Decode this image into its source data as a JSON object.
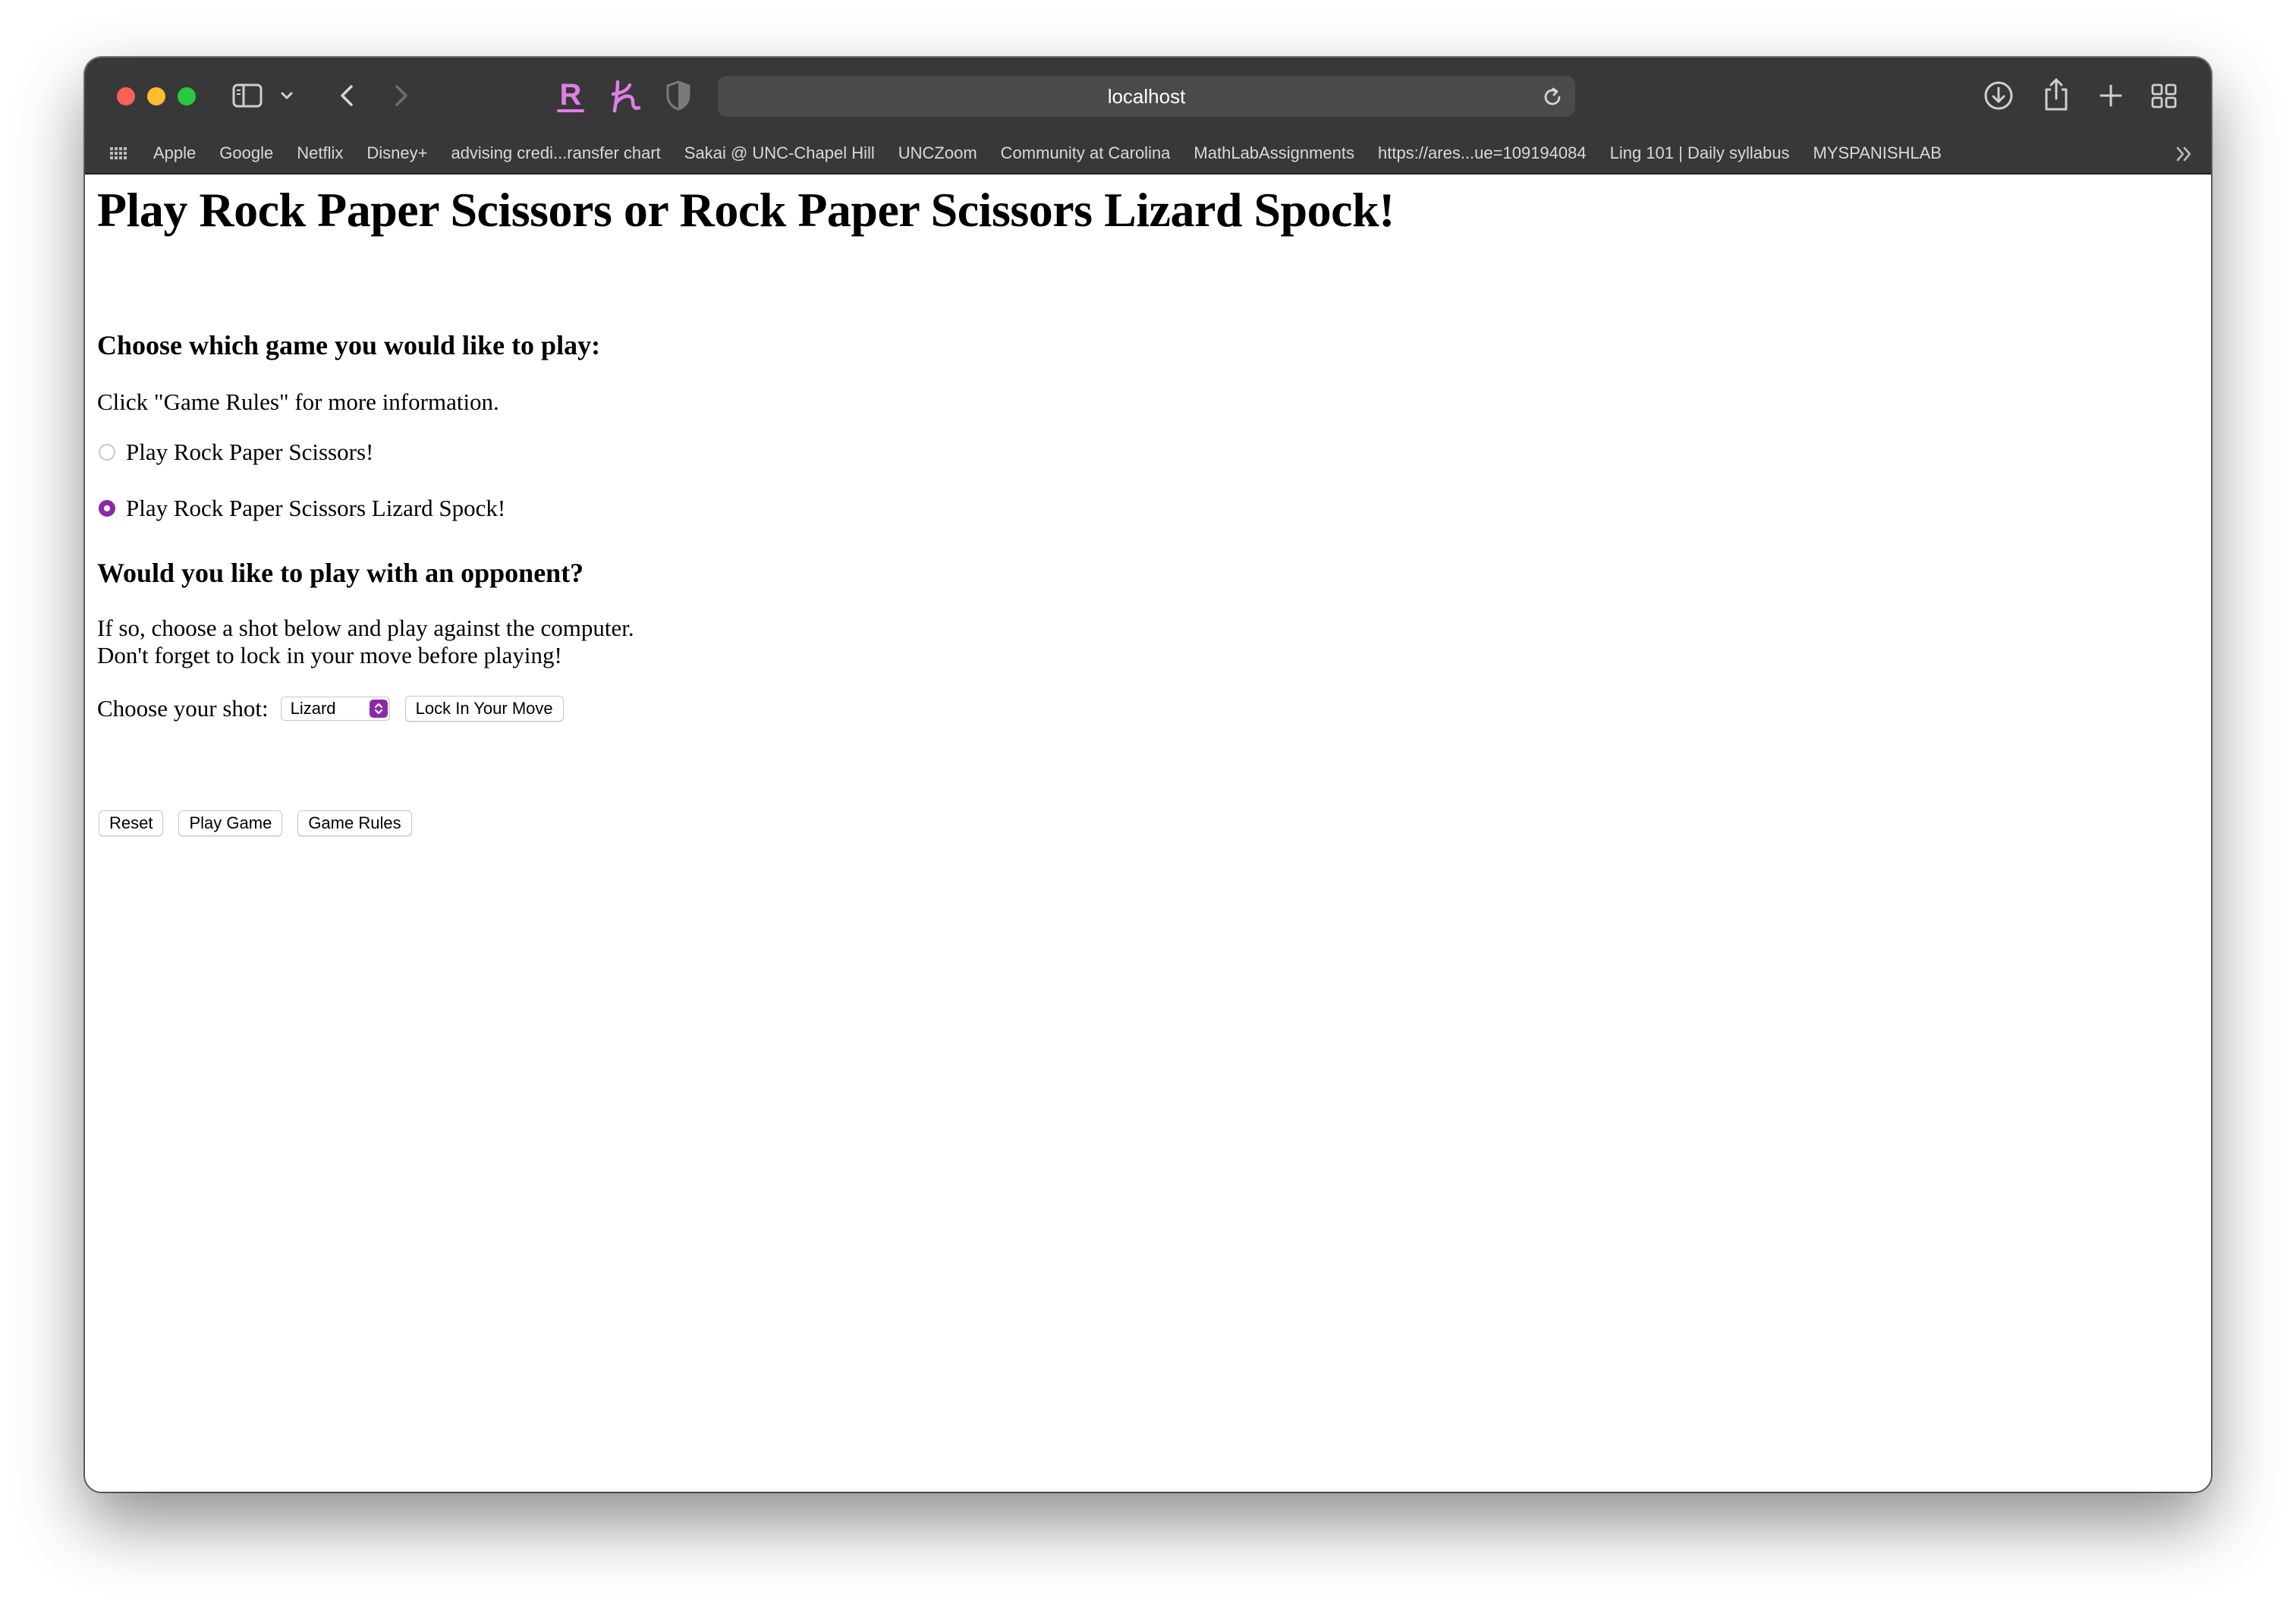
{
  "browser": {
    "address": "localhost",
    "bookmarks": [
      "Apple",
      "Google",
      "Netflix",
      "Disney+",
      "advising credi...ransfer chart",
      "Sakai @ UNC-Chapel Hill",
      "UNCZoom",
      "Community at Carolina",
      "MathLabAssignments",
      "https://ares...ue=109194084",
      "Ling 101 | Daily syllabus",
      "MYSPANISHLAB"
    ],
    "icons": {
      "sidebar": "sidebar-icon",
      "back": "chevron-left-icon",
      "forward": "chevron-right-icon",
      "reload": "reload-icon",
      "download": "download-icon",
      "share": "share-icon",
      "new_tab": "plus-icon",
      "tab_overview": "grid-icon"
    },
    "extensions": {
      "r_logo_letter": "R",
      "h_logo_letter": "h"
    },
    "colors": {
      "chrome": "#383838",
      "accent": "#8a2aa6",
      "extension": "#e07fe8"
    }
  },
  "page": {
    "title": "Play Rock Paper Scissors or Rock Paper Scissors Lizard Spock!",
    "choose_heading": "Choose which game you would like to play:",
    "info_text": "Click \"Game Rules\" for more information.",
    "game_options": [
      {
        "label": "Play Rock Paper Scissors!",
        "checked": false
      },
      {
        "label": "Play Rock Paper Scissors Lizard Spock!",
        "checked": true
      }
    ],
    "opponent_heading": "Would you like to play with an opponent?",
    "opponent_line1": "If so, choose a shot below and play against the computer.",
    "opponent_line2": "Don't forget to lock in your move before playing!",
    "shot_label": "Choose your shot:",
    "shot_selected": "Lizard",
    "lock_button": "Lock In Your Move",
    "buttons": {
      "reset": "Reset",
      "play": "Play Game",
      "rules": "Game Rules"
    }
  }
}
